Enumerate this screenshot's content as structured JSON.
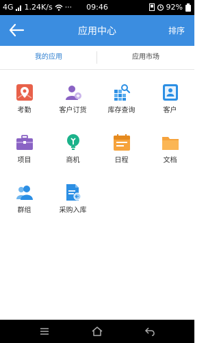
{
  "status_bar": {
    "network": "4G",
    "speed": "1.24K/s",
    "more": "···",
    "time": "09:46",
    "battery": "92%"
  },
  "app_bar": {
    "title": "应用中心",
    "action": "排序"
  },
  "tabs": [
    {
      "label": "我的应用",
      "active": true
    },
    {
      "label": "应用市场",
      "active": false
    }
  ],
  "apps": [
    {
      "label": "考勤",
      "icon": "attendance-icon"
    },
    {
      "label": "客户订货",
      "icon": "customer-order-icon"
    },
    {
      "label": "库存查询",
      "icon": "inventory-query-icon"
    },
    {
      "label": "客户",
      "icon": "customer-icon"
    },
    {
      "label": "项目",
      "icon": "project-icon"
    },
    {
      "label": "商机",
      "icon": "opportunity-icon"
    },
    {
      "label": "日程",
      "icon": "schedule-icon"
    },
    {
      "label": "文档",
      "icon": "document-icon"
    },
    {
      "label": "群组",
      "icon": "group-icon"
    },
    {
      "label": "采购入库",
      "icon": "purchase-inbound-icon"
    }
  ],
  "colors": {
    "primary": "#3b8de0",
    "tab_active": "#2f7fd0",
    "attendance_red": "#e8614a",
    "purple": "#8a63c4",
    "blue": "#2c8fe4",
    "teal": "#1bb28a",
    "orange": "#f6a33c"
  }
}
